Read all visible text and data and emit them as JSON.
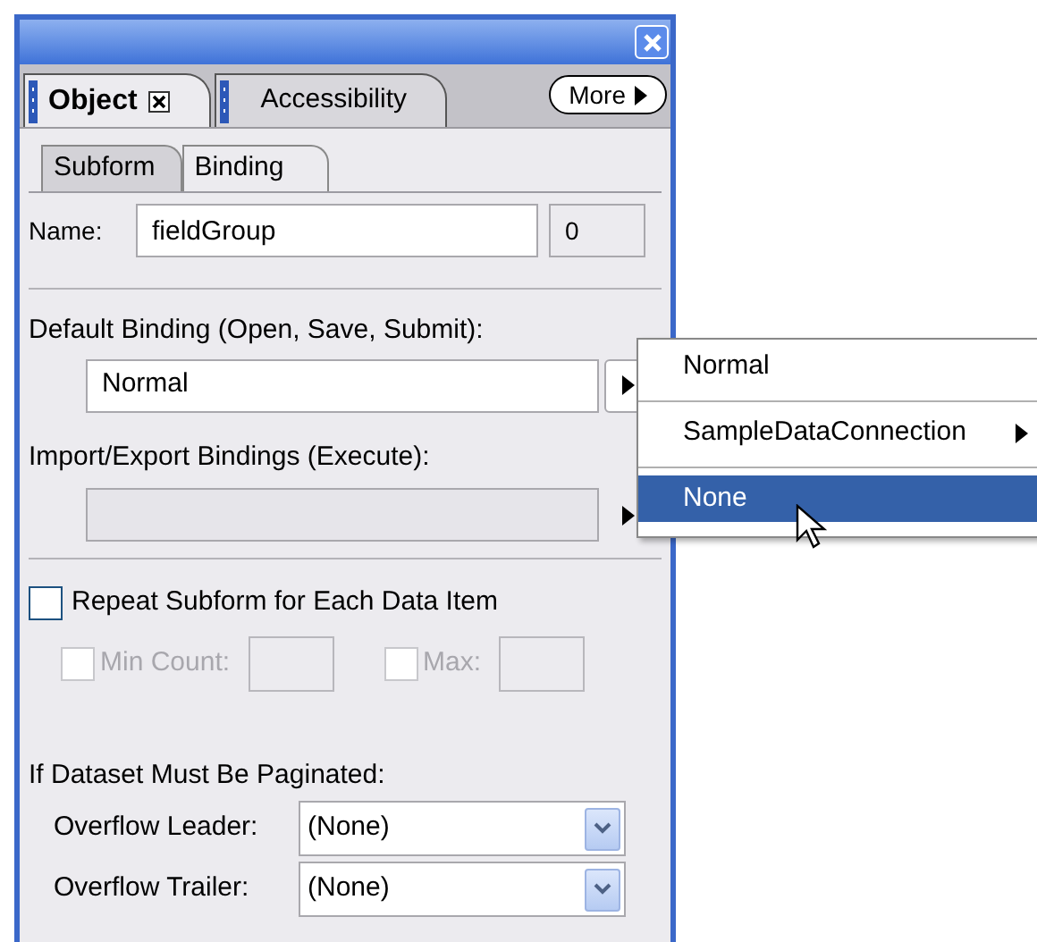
{
  "panel_tabs": [
    {
      "label": "Object",
      "selected": true,
      "closable": true
    },
    {
      "label": "Accessibility",
      "selected": false,
      "closable": false
    }
  ],
  "more_button": {
    "label": "More"
  },
  "sub_tabs": [
    {
      "label": "Subform",
      "selected": false
    },
    {
      "label": "Binding",
      "selected": true
    }
  ],
  "name": {
    "label": "Name:",
    "value": "fieldGroup",
    "index": "0"
  },
  "default_binding": {
    "label": "Default Binding (Open, Save, Submit):",
    "value": "Normal"
  },
  "binding_menu": [
    {
      "label": "Normal",
      "selected": false,
      "submenu": false
    },
    {
      "label": "SampleDataConnection",
      "selected": false,
      "submenu": true
    },
    {
      "label": "None",
      "selected": true,
      "submenu": false
    }
  ],
  "import_export": {
    "label": "Import/Export Bindings (Execute):",
    "disabled": true
  },
  "repeat": {
    "label": "Repeat Subform for Each Data Item",
    "checked": false
  },
  "counts": [
    {
      "label": "Min Count:",
      "checked": false,
      "disabled": true
    },
    {
      "label": "Max:",
      "checked": false,
      "disabled": true
    }
  ],
  "pagination": {
    "label": "If Dataset Must Be Paginated:",
    "fields": [
      {
        "label": "Overflow Leader:",
        "value": "(None)"
      },
      {
        "label": "Overflow Trailer:",
        "value": "(None)"
      }
    ]
  }
}
